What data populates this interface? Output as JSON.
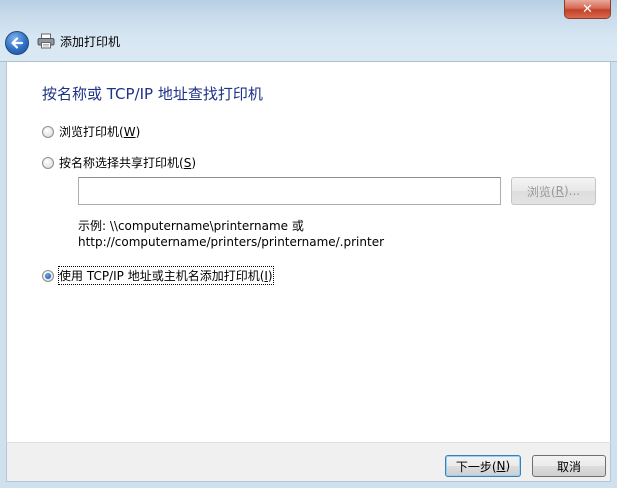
{
  "window": {
    "title": "添加打印机",
    "close_glyph": "✕"
  },
  "page": {
    "heading": "按名称或 TCP/IP 地址查找打印机"
  },
  "options": {
    "browse": {
      "label_prefix": "浏览打印机(",
      "accel": "W",
      "label_suffix": ")",
      "checked": false
    },
    "share": {
      "label_prefix": "按名称选择共享打印机(",
      "accel": "S",
      "label_suffix": ")",
      "checked": false
    },
    "tcpip": {
      "label_prefix": "使用 TCP/IP 地址或主机名添加打印机(",
      "accel": "I",
      "label_suffix": ")",
      "checked": true
    }
  },
  "share_input": {
    "value": ""
  },
  "browse_button": {
    "label_prefix": "浏览(",
    "accel": "R",
    "label_suffix": ")..."
  },
  "example": {
    "line1": "示例: \\\\computername\\printername 或",
    "line2": "http://computername/printers/printername/.printer"
  },
  "footer": {
    "next": {
      "label_prefix": "下一步(",
      "accel": "N",
      "label_suffix": ")"
    },
    "cancel": {
      "label": "取消"
    }
  },
  "colors": {
    "heading": "#1e3287",
    "close_button": "#c2412a",
    "back_button": "#2f6fc4"
  },
  "icons": {
    "back": "back-arrow-icon",
    "printer": "printer-icon",
    "close": "close-icon"
  }
}
